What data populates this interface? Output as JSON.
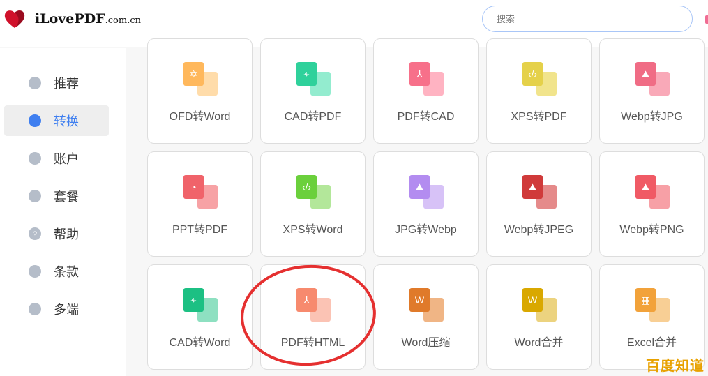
{
  "header": {
    "brand": "iLovePDF",
    "brand_suffix": ".com.cn",
    "search_placeholder": "搜索"
  },
  "sidebar": {
    "items": [
      {
        "label": "推荐",
        "icon": "gift-icon"
      },
      {
        "label": "转换",
        "icon": "convert-icon",
        "active": true
      },
      {
        "label": "账户",
        "icon": "user-icon"
      },
      {
        "label": "套餐",
        "icon": "card-icon"
      },
      {
        "label": "帮助",
        "icon": "help-icon"
      },
      {
        "label": "条款",
        "icon": "terms-icon"
      },
      {
        "label": "多端",
        "icon": "devices-icon"
      }
    ]
  },
  "tools": [
    {
      "label": "OFD转Word",
      "front": "#ffb85c",
      "back": "#ffdcaa",
      "glyph": "✡"
    },
    {
      "label": "CAD转PDF",
      "front": "#2fd19b",
      "back": "#93eccf",
      "glyph": "⌖"
    },
    {
      "label": "PDF转CAD",
      "front": "#f7708a",
      "back": "#ffb3c2",
      "glyph": "⅄"
    },
    {
      "label": "XPS转PDF",
      "front": "#e5d14a",
      "back": "#f1e48c",
      "glyph": "‹/›"
    },
    {
      "label": "Webp转JPG",
      "front": "#f06c85",
      "back": "#f9a9b8",
      "glyph": "⛰"
    },
    {
      "label": "PPT转PDF",
      "front": "#f0636a",
      "back": "#f7a2a5",
      "glyph": "◔"
    },
    {
      "label": "XPS转Word",
      "front": "#6bd03c",
      "back": "#b3e79a",
      "glyph": "‹/›"
    },
    {
      "label": "JPG转Webp",
      "front": "#b38cf0",
      "back": "#d7c2f7",
      "glyph": "⛰"
    },
    {
      "label": "Webp转JPEG",
      "front": "#d03a3a",
      "back": "#e58a8a",
      "glyph": "⛰"
    },
    {
      "label": "Webp转PNG",
      "front": "#f05a65",
      "back": "#f7a0a6",
      "glyph": "⛰"
    },
    {
      "label": "CAD转Word",
      "front": "#1cc083",
      "back": "#8ee0c1",
      "glyph": "⌖"
    },
    {
      "label": "PDF转HTML",
      "front": "#f78a6e",
      "back": "#fbc3b4",
      "glyph": "⅄"
    },
    {
      "label": "Word压缩",
      "front": "#e07a2a",
      "back": "#f0b585",
      "glyph": "W"
    },
    {
      "label": "Word合并",
      "front": "#d9a800",
      "back": "#ecd37f",
      "glyph": "W"
    },
    {
      "label": "Excel合并",
      "front": "#f2a23a",
      "back": "#f8cf95",
      "glyph": "▦"
    }
  ],
  "annotation": {
    "color": "#e53030"
  },
  "watermark": "百度知道"
}
